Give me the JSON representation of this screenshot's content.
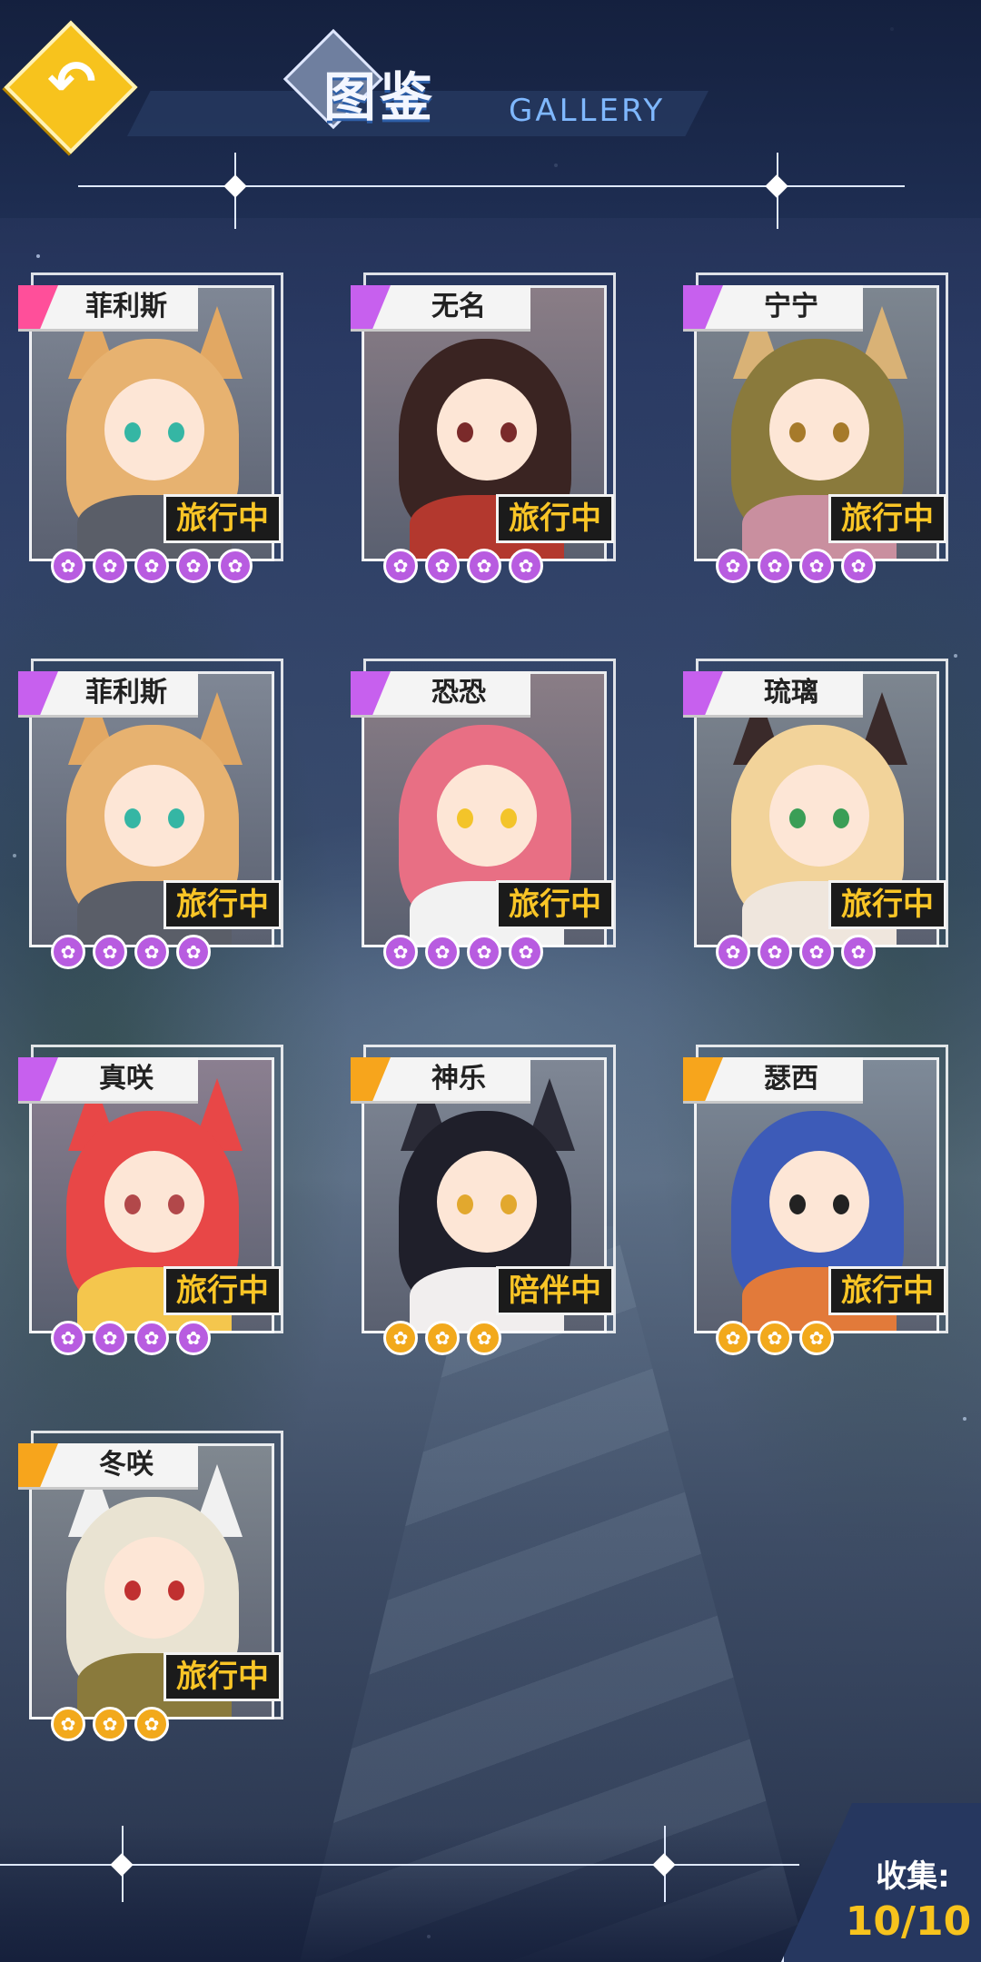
{
  "header": {
    "back_icon": "back-arrow-icon",
    "title_cn": "图鉴",
    "title_en": "GALLERY",
    "back_symbol": "↶"
  },
  "cards": [
    {
      "name": "菲利斯",
      "status": "旅行中",
      "paws": 5,
      "tier": "pink",
      "paw_color": "purple"
    },
    {
      "name": "无名",
      "status": "旅行中",
      "paws": 4,
      "tier": "purple",
      "paw_color": "purple"
    },
    {
      "name": "宁宁",
      "status": "旅行中",
      "paws": 4,
      "tier": "purple",
      "paw_color": "purple"
    },
    {
      "name": "菲利斯",
      "status": "旅行中",
      "paws": 4,
      "tier": "purple",
      "paw_color": "purple"
    },
    {
      "name": "恐恐",
      "status": "旅行中",
      "paws": 4,
      "tier": "purple",
      "paw_color": "purple"
    },
    {
      "name": "琉璃",
      "status": "旅行中",
      "paws": 4,
      "tier": "purple",
      "paw_color": "purple"
    },
    {
      "name": "真咲",
      "status": "旅行中",
      "paws": 4,
      "tier": "purple",
      "paw_color": "purple"
    },
    {
      "name": "神乐",
      "status": "陪伴中",
      "paws": 3,
      "tier": "orange",
      "paw_color": "orange"
    },
    {
      "name": "瑟西",
      "status": "旅行中",
      "paws": 3,
      "tier": "orange",
      "paw_color": "orange"
    },
    {
      "name": "冬咲",
      "status": "旅行中",
      "paws": 3,
      "tier": "orange",
      "paw_color": "orange"
    }
  ],
  "footer": {
    "collect_label": "收集:",
    "collect_count": "10/10"
  },
  "colors": {
    "accent_gold": "#f7c31d",
    "flag_pink": "#ff4f9a",
    "flag_purple": "#c760ee",
    "flag_orange": "#f7a51c"
  }
}
